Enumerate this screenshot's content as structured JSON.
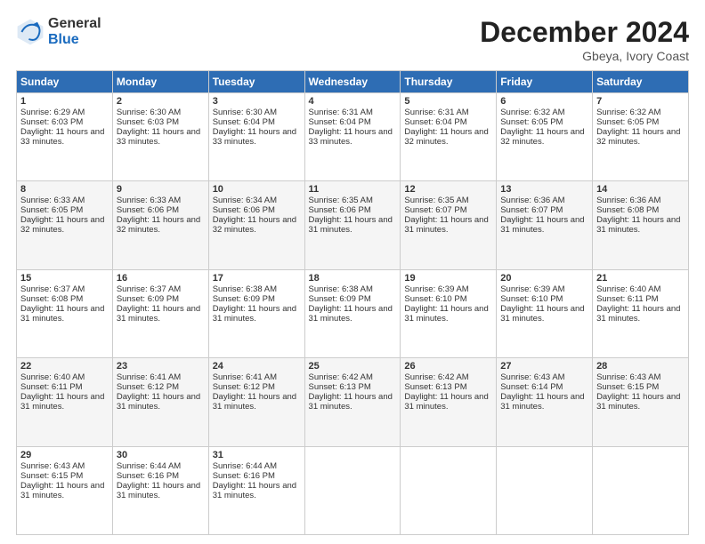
{
  "logo": {
    "general": "General",
    "blue": "Blue"
  },
  "header": {
    "month": "December 2024",
    "location": "Gbeya, Ivory Coast"
  },
  "days": [
    "Sunday",
    "Monday",
    "Tuesday",
    "Wednesday",
    "Thursday",
    "Friday",
    "Saturday"
  ],
  "weeks": [
    [
      {
        "day": "1",
        "sunrise": "6:29 AM",
        "sunset": "6:03 PM",
        "daylight": "11 hours and 33 minutes."
      },
      {
        "day": "2",
        "sunrise": "6:30 AM",
        "sunset": "6:03 PM",
        "daylight": "11 hours and 33 minutes."
      },
      {
        "day": "3",
        "sunrise": "6:30 AM",
        "sunset": "6:04 PM",
        "daylight": "11 hours and 33 minutes."
      },
      {
        "day": "4",
        "sunrise": "6:31 AM",
        "sunset": "6:04 PM",
        "daylight": "11 hours and 33 minutes."
      },
      {
        "day": "5",
        "sunrise": "6:31 AM",
        "sunset": "6:04 PM",
        "daylight": "11 hours and 32 minutes."
      },
      {
        "day": "6",
        "sunrise": "6:32 AM",
        "sunset": "6:05 PM",
        "daylight": "11 hours and 32 minutes."
      },
      {
        "day": "7",
        "sunrise": "6:32 AM",
        "sunset": "6:05 PM",
        "daylight": "11 hours and 32 minutes."
      }
    ],
    [
      {
        "day": "8",
        "sunrise": "6:33 AM",
        "sunset": "6:05 PM",
        "daylight": "11 hours and 32 minutes."
      },
      {
        "day": "9",
        "sunrise": "6:33 AM",
        "sunset": "6:06 PM",
        "daylight": "11 hours and 32 minutes."
      },
      {
        "day": "10",
        "sunrise": "6:34 AM",
        "sunset": "6:06 PM",
        "daylight": "11 hours and 32 minutes."
      },
      {
        "day": "11",
        "sunrise": "6:35 AM",
        "sunset": "6:06 PM",
        "daylight": "11 hours and 31 minutes."
      },
      {
        "day": "12",
        "sunrise": "6:35 AM",
        "sunset": "6:07 PM",
        "daylight": "11 hours and 31 minutes."
      },
      {
        "day": "13",
        "sunrise": "6:36 AM",
        "sunset": "6:07 PM",
        "daylight": "11 hours and 31 minutes."
      },
      {
        "day": "14",
        "sunrise": "6:36 AM",
        "sunset": "6:08 PM",
        "daylight": "11 hours and 31 minutes."
      }
    ],
    [
      {
        "day": "15",
        "sunrise": "6:37 AM",
        "sunset": "6:08 PM",
        "daylight": "11 hours and 31 minutes."
      },
      {
        "day": "16",
        "sunrise": "6:37 AM",
        "sunset": "6:09 PM",
        "daylight": "11 hours and 31 minutes."
      },
      {
        "day": "17",
        "sunrise": "6:38 AM",
        "sunset": "6:09 PM",
        "daylight": "11 hours and 31 minutes."
      },
      {
        "day": "18",
        "sunrise": "6:38 AM",
        "sunset": "6:09 PM",
        "daylight": "11 hours and 31 minutes."
      },
      {
        "day": "19",
        "sunrise": "6:39 AM",
        "sunset": "6:10 PM",
        "daylight": "11 hours and 31 minutes."
      },
      {
        "day": "20",
        "sunrise": "6:39 AM",
        "sunset": "6:10 PM",
        "daylight": "11 hours and 31 minutes."
      },
      {
        "day": "21",
        "sunrise": "6:40 AM",
        "sunset": "6:11 PM",
        "daylight": "11 hours and 31 minutes."
      }
    ],
    [
      {
        "day": "22",
        "sunrise": "6:40 AM",
        "sunset": "6:11 PM",
        "daylight": "11 hours and 31 minutes."
      },
      {
        "day": "23",
        "sunrise": "6:41 AM",
        "sunset": "6:12 PM",
        "daylight": "11 hours and 31 minutes."
      },
      {
        "day": "24",
        "sunrise": "6:41 AM",
        "sunset": "6:12 PM",
        "daylight": "11 hours and 31 minutes."
      },
      {
        "day": "25",
        "sunrise": "6:42 AM",
        "sunset": "6:13 PM",
        "daylight": "11 hours and 31 minutes."
      },
      {
        "day": "26",
        "sunrise": "6:42 AM",
        "sunset": "6:13 PM",
        "daylight": "11 hours and 31 minutes."
      },
      {
        "day": "27",
        "sunrise": "6:43 AM",
        "sunset": "6:14 PM",
        "daylight": "11 hours and 31 minutes."
      },
      {
        "day": "28",
        "sunrise": "6:43 AM",
        "sunset": "6:15 PM",
        "daylight": "11 hours and 31 minutes."
      }
    ],
    [
      {
        "day": "29",
        "sunrise": "6:43 AM",
        "sunset": "6:15 PM",
        "daylight": "11 hours and 31 minutes."
      },
      {
        "day": "30",
        "sunrise": "6:44 AM",
        "sunset": "6:16 PM",
        "daylight": "11 hours and 31 minutes."
      },
      {
        "day": "31",
        "sunrise": "6:44 AM",
        "sunset": "6:16 PM",
        "daylight": "11 hours and 31 minutes."
      },
      null,
      null,
      null,
      null
    ]
  ]
}
